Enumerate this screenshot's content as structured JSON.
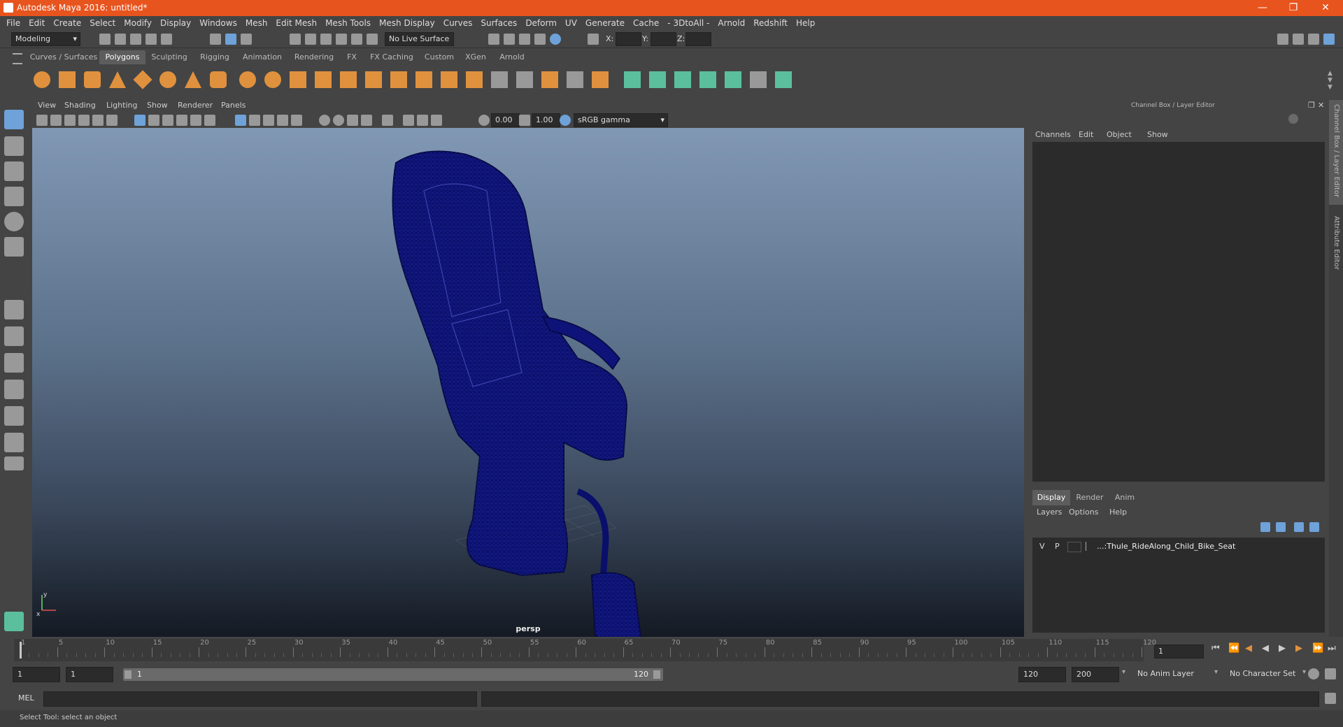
{
  "app": {
    "title": "Autodesk Maya 2016: untitled*"
  },
  "menubar": [
    "File",
    "Edit",
    "Create",
    "Select",
    "Modify",
    "Display",
    "Windows",
    "Mesh",
    "Edit Mesh",
    "Mesh Tools",
    "Mesh Display",
    "Curves",
    "Surfaces",
    "Deform",
    "UV",
    "Generate",
    "Cache",
    "- 3DtoAll -",
    "Arnold",
    "Redshift",
    "Help"
  ],
  "status": {
    "mode": "Modeling",
    "live_surface": "No Live Surface",
    "x_label": "X:",
    "y_label": "Y:",
    "z_label": "Z:"
  },
  "shelf_tabs": [
    "Curves / Surfaces",
    "Polygons",
    "Sculpting",
    "Rigging",
    "Animation",
    "Rendering",
    "FX",
    "FX Caching",
    "Custom",
    "XGen",
    "Arnold"
  ],
  "shelf_active": "Polygons",
  "viewport": {
    "menu": [
      "View",
      "Shading",
      "Lighting",
      "Show",
      "Renderer",
      "Panels"
    ],
    "exposure": "0.00",
    "gamma": "1.00",
    "color_space": "sRGB gamma",
    "camera_label": "persp",
    "axis_x": "x",
    "axis_y": "y"
  },
  "channel_box": {
    "header": "Channel Box / Layer Editor",
    "menu": [
      "Channels",
      "Edit",
      "Object",
      "Show"
    ]
  },
  "layer_editor": {
    "tabs": [
      "Display",
      "Render",
      "Anim"
    ],
    "active_tab": "Display",
    "menu": [
      "Layers",
      "Options",
      "Help"
    ],
    "layer": {
      "v": "V",
      "p": "P",
      "name": "...:Thule_RideAlong_Child_Bike_Seat"
    }
  },
  "side_tabs": [
    "Channel Box / Layer Editor",
    "Attribute Editor"
  ],
  "timeline": {
    "ticks": [
      "1",
      "5",
      "10",
      "15",
      "20",
      "25",
      "30",
      "35",
      "40",
      "45",
      "50",
      "55",
      "60",
      "65",
      "70",
      "75",
      "80",
      "85",
      "90",
      "95",
      "100",
      "105",
      "110",
      "115",
      "120"
    ],
    "current_frame": "1"
  },
  "range": {
    "start": "1",
    "playback_start": "1",
    "slider_start": "1",
    "slider_end": "120",
    "playback_end": "120",
    "end": "200",
    "anim_layer": "No Anim Layer",
    "character_set": "No Character Set"
  },
  "mel": {
    "label": "MEL"
  },
  "help_line": "Select Tool: select an object",
  "colors": {
    "title_bar": "#e8541e",
    "wireframe": "#0a0f6b",
    "shelf_icon": "#e0913e",
    "shelf_icon_alt": "#5bbf9d"
  }
}
